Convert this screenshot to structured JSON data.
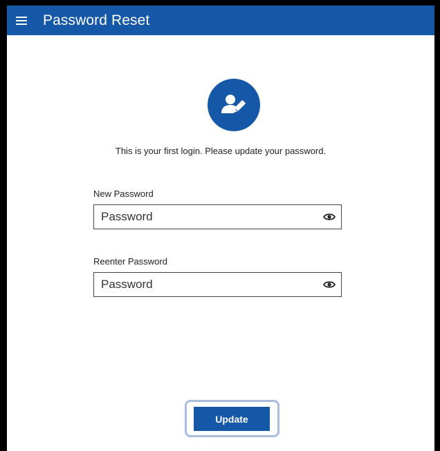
{
  "header": {
    "menu_icon": "hamburger-menu-icon",
    "title": "Password Reset",
    "color": "#1658a8"
  },
  "avatar": {
    "icon": "user-edit-icon",
    "color": "#1658a8"
  },
  "message": "This is your first login. Please update your password.",
  "fields": [
    {
      "label": "New Password",
      "placeholder": "Password",
      "value": "",
      "toggle_icon": "eye-icon"
    },
    {
      "label": "Reenter Password",
      "placeholder": "Password",
      "value": "",
      "toggle_icon": "eye-icon"
    }
  ],
  "update_button": {
    "label": "Update",
    "color": "#1658a8"
  }
}
